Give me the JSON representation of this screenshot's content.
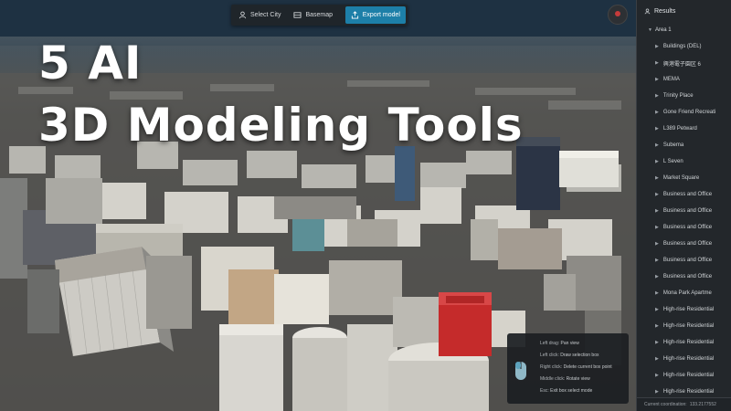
{
  "headline": {
    "line1": "5 AI",
    "line2": "3D Modeling Tools"
  },
  "toolbar": {
    "select_city": "Select City",
    "basemap": "Basemap",
    "export_model": "Export model"
  },
  "results": {
    "title": "Results",
    "area": "Area 1",
    "items": [
      "Buildings (DEL)",
      "興港電子園区 6",
      "MEMA",
      "Trinity Place",
      "Gone Friend Recreati",
      "L389 Petward",
      "Subema",
      "L Seven",
      "Market Square",
      "Business and Office",
      "Business and Office",
      "Business and Office",
      "Business and Office",
      "Business and Office",
      "Business and Office",
      "Mona Park Apartme",
      "High-rise Residential",
      "High-rise Residential",
      "High-rise Residential",
      "High-rise Residential",
      "High-rise Residential",
      "High-rise Residential"
    ],
    "footer_label": "Current coordination:",
    "footer_value": "133.2177552"
  },
  "help": {
    "rows": [
      {
        "key": "Left drag:",
        "value": "Pan view"
      },
      {
        "key": "Left click:",
        "value": "Draw selection box"
      },
      {
        "key": "Right click:",
        "value": "Delete current box point"
      },
      {
        "key": "Middle click:",
        "value": "Rotate view"
      },
      {
        "key": "Esc:",
        "value": "Exit box select mode"
      }
    ]
  },
  "colors": {
    "accent": "#1d7fa8",
    "panel": "#23272b",
    "red_building": "#c52b2b"
  }
}
